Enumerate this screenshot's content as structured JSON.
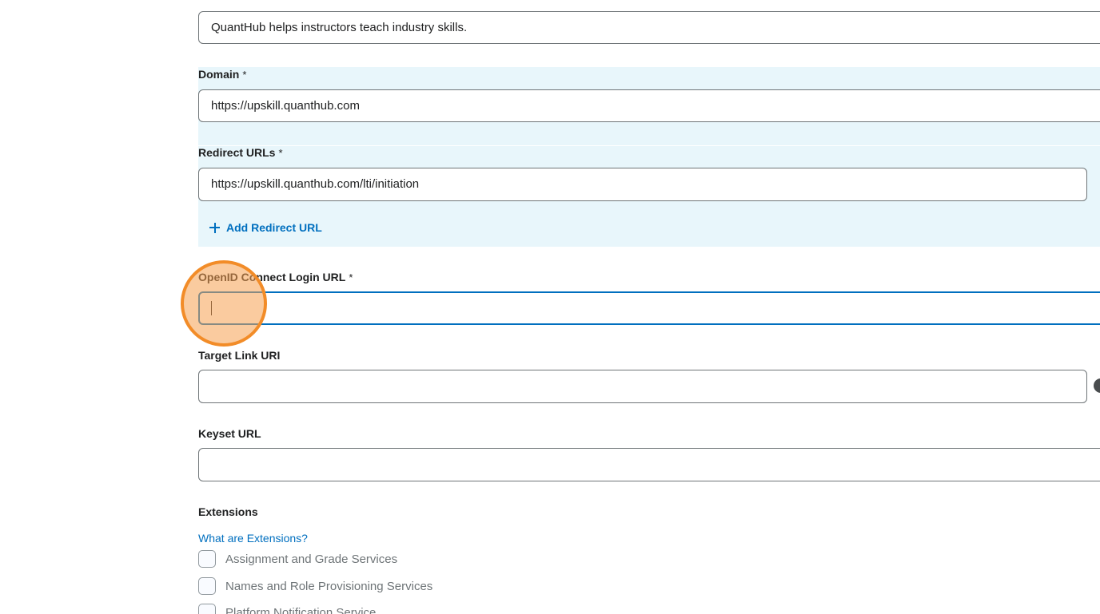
{
  "form": {
    "description": {
      "value": "QuantHub helps instructors teach industry skills."
    },
    "domain": {
      "label": "Domain",
      "required_mark": "*",
      "value": "https://upskill.quanthub.com"
    },
    "redirect_urls": {
      "label": "Redirect URLs",
      "required_mark": "*",
      "value": "https://upskill.quanthub.com/lti/initiation",
      "add_label": "Add Redirect URL"
    },
    "openid_login_url": {
      "label": "OpenID Connect Login URL",
      "required_mark": "*",
      "value": ""
    },
    "target_link_uri": {
      "label": "Target Link URI",
      "value": ""
    },
    "keyset_url": {
      "label": "Keyset URL",
      "value": ""
    },
    "extensions": {
      "heading": "Extensions",
      "help_link": "What are Extensions?",
      "options": [
        {
          "label": "Assignment and Grade Services",
          "checked": false
        },
        {
          "label": "Names and Role Provisioning Services",
          "checked": false
        },
        {
          "label": "Platform Notification Service",
          "checked": false
        }
      ]
    }
  },
  "icons": {
    "add": "plus-icon",
    "help": "help-icon"
  },
  "colors": {
    "link": "#006fbf",
    "focus_border": "#006fbf",
    "highlight_band": "#e8f6fb",
    "click_marker": "#f28c28"
  }
}
